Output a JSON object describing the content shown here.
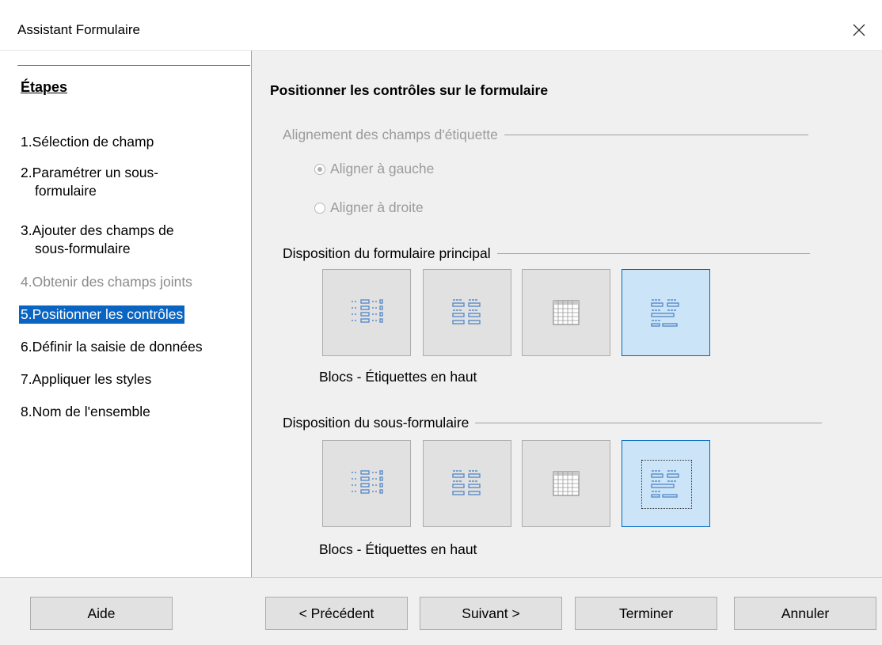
{
  "window": {
    "title": "Assistant Formulaire"
  },
  "steps": {
    "heading": "Étapes",
    "items": [
      {
        "num": "1.",
        "label": "Sélection de champ",
        "state": "normal"
      },
      {
        "num": "2.",
        "label": "Paramétrer un sous-",
        "label2": "formulaire",
        "state": "normal"
      },
      {
        "num": "3.",
        "label": "Ajouter des champs de",
        "label2": "sous-formulaire",
        "state": "normal"
      },
      {
        "num": "4.",
        "label": "Obtenir des champs joints",
        "state": "disabled"
      },
      {
        "num": "5.",
        "label": "Positionner les contrôles",
        "state": "active"
      },
      {
        "num": "6.",
        "label": "Définir la saisie de données",
        "state": "normal"
      },
      {
        "num": "7.",
        "label": "Appliquer les styles",
        "state": "normal"
      },
      {
        "num": "8.",
        "label": "Nom de l'ensemble",
        "state": "normal"
      }
    ]
  },
  "content": {
    "heading": "Positionner les contrôles sur le formulaire",
    "label_alignment": {
      "title": "Alignement des champs d'étiquette",
      "options": [
        {
          "label": "Aligner à gauche",
          "checked": true
        },
        {
          "label": "Aligner à droite",
          "checked": false
        }
      ]
    },
    "main_layout": {
      "title": "Disposition du formulaire principal",
      "selected_caption": "Blocs - Étiquettes en haut",
      "options": [
        {
          "icon": "columnar-labels-left-icon"
        },
        {
          "icon": "columnar-labels-top-icon"
        },
        {
          "icon": "datasheet-grid-icon"
        },
        {
          "icon": "blocks-labels-top-icon"
        }
      ],
      "selected_index": 3
    },
    "sub_layout": {
      "title": "Disposition du sous-formulaire",
      "selected_caption": "Blocs - Étiquettes en haut",
      "options": [
        {
          "icon": "columnar-labels-left-icon"
        },
        {
          "icon": "columnar-labels-top-icon"
        },
        {
          "icon": "datasheet-grid-icon"
        },
        {
          "icon": "blocks-labels-top-icon"
        }
      ],
      "selected_index": 3
    }
  },
  "buttons": {
    "help": "Aide",
    "previous": "< Précédent",
    "next": "Suivant >",
    "finish": "Terminer",
    "cancel": "Annuler"
  },
  "colors": {
    "accent": "#0a64c2",
    "selected_bg": "#cce4f7",
    "icon_blue": "#5b8cc9"
  }
}
